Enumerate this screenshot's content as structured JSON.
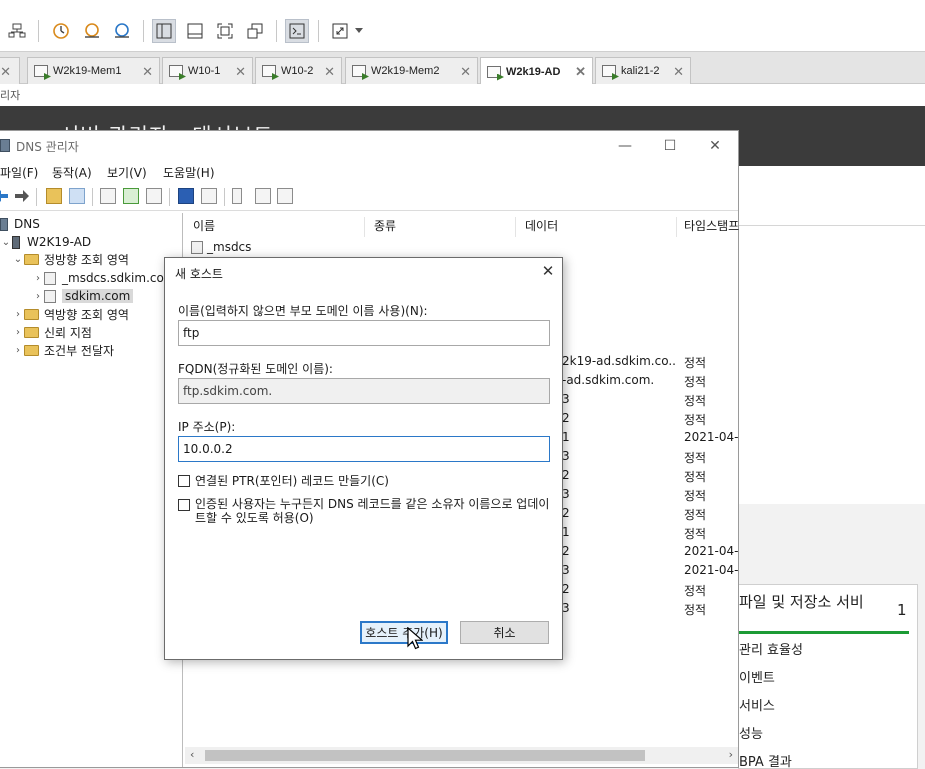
{
  "vm_tabs": [
    {
      "label": "W2k19-Mem1"
    },
    {
      "label": "W10-1"
    },
    {
      "label": "W10-2"
    },
    {
      "label": "W2k19-Mem2"
    },
    {
      "label": "W2k19-AD",
      "active": true
    },
    {
      "label": "kali21-2"
    }
  ],
  "breadcrumb": "리자",
  "server_manager": {
    "title_fragment": "서버 관리자 · 대시보드",
    "tile": {
      "title": "파일 및 저장소 서비",
      "count": "1",
      "rows": [
        "관리 효율성",
        "이벤트",
        "서비스",
        "성능",
        "BPA 결과"
      ]
    }
  },
  "dns_window": {
    "title": "DNS 관리자",
    "menu": [
      "파일(F)",
      "동작(A)",
      "보기(V)",
      "도움말(H)"
    ],
    "tree": {
      "root": "DNS",
      "server": "W2K19-AD",
      "forward_zone": "정방향 조회 영역",
      "msdcs_zone": "_msdcs.sdkim.com",
      "sdkim_zone": "sdkim.com",
      "reverse_zone": "역방향 조회 영역",
      "trust_points": "신뢰 지점",
      "conditional_forwarders": "조건부 전달자"
    },
    "list": {
      "columns": [
        "이름",
        "종류",
        "데이터",
        "타임스탬프"
      ],
      "first_row_name": "_msdcs",
      "data_fragments": [
        "2k19-ad.sdkim.co...",
        "-ad.sdkim.com.",
        "3",
        "2",
        "1",
        "3",
        "2",
        "3",
        "2",
        "1",
        "2",
        "3",
        "2",
        "3"
      ],
      "timestamps": [
        "정적",
        "정적",
        "정적",
        "정적",
        "2021-04-",
        "정적",
        "정적",
        "정적",
        "정적",
        "정적",
        "2021-04-",
        "2021-04-",
        "정적",
        "정적"
      ]
    }
  },
  "new_host_dialog": {
    "title": "새 호스트",
    "name_label": "이름(입력하지 않으면 부모 도메인 이름 사용)(N):",
    "name_value": "ftp",
    "fqdn_label": "FQDN(정규화된 도메인 이름):",
    "fqdn_value": "ftp.sdkim.com.",
    "ip_label": "IP 주소(P):",
    "ip_value": "10.0.0.2",
    "ptr_checkbox": "연결된 PTR(포인터) 레코드 만들기(C)",
    "auth_checkbox": "인증된 사용자는 누구든지 DNS 레코드를 같은 소유자 이름으로 업데이트할 수 있도록 허용(O)",
    "add_button": "호스트 추가(H)",
    "cancel_button": "취소"
  },
  "colors": {
    "accent_blue": "#2b78c8",
    "server_manager_header": "#3b3b3b",
    "tile_status_green": "#1c9b35"
  }
}
